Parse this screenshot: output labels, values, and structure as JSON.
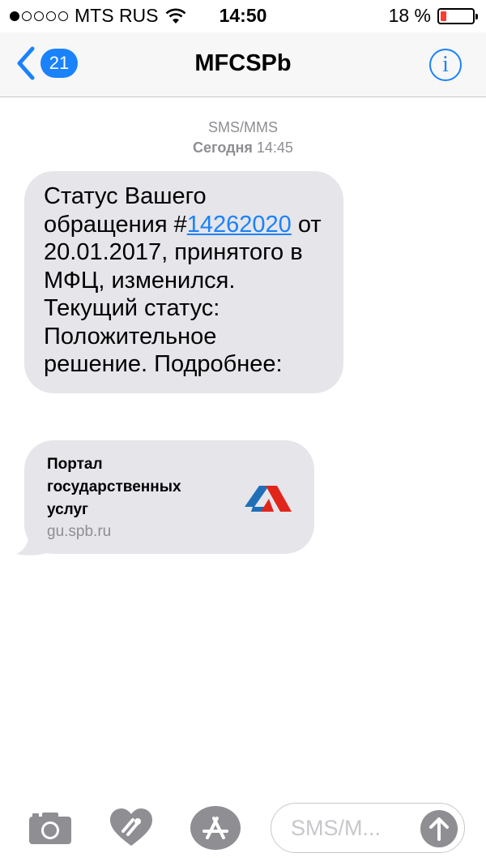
{
  "status_bar": {
    "carrier": "MTS RUS",
    "time": "14:50",
    "battery_text": "18 %",
    "battery_level": 0.18,
    "signal_bars_filled": 1,
    "signal_bars_total": 5
  },
  "nav": {
    "back_count": "21",
    "title": "MFCSPb",
    "info_glyph": "i"
  },
  "conversation": {
    "type": "SMS/MMS",
    "day": "Сегодня",
    "time": "14:45"
  },
  "message": {
    "text_before": "Статус Вашего обращения #",
    "link_text": "14262020",
    "text_after": " от 20.01.2017, принятого в МФЦ, изменился. Текущий статус: Положительное решение. Подробнее:"
  },
  "link_preview": {
    "title": "Портал государственных услуг",
    "domain": "gu.spb.ru",
    "logo_colors": [
      "#1f6fb8",
      "#e1251b"
    ]
  },
  "input_bar": {
    "placeholder": "SMS/M...",
    "icons": [
      "camera-icon",
      "digital-touch-icon",
      "app-store-icon",
      "send-arrow-icon"
    ]
  },
  "colors": {
    "accent": "#1a82fb",
    "bubble": "#e5e5ea",
    "secondary_text": "#8e8e93",
    "battery_low": "#ff3b30"
  }
}
